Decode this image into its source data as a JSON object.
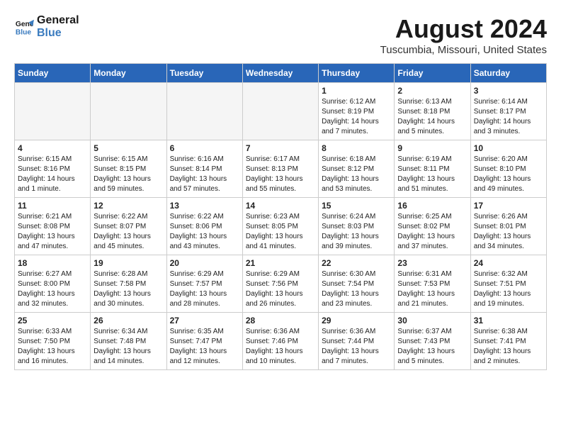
{
  "header": {
    "logo_line1": "General",
    "logo_line2": "Blue",
    "month_title": "August 2024",
    "location": "Tuscumbia, Missouri, United States"
  },
  "weekdays": [
    "Sunday",
    "Monday",
    "Tuesday",
    "Wednesday",
    "Thursday",
    "Friday",
    "Saturday"
  ],
  "weeks": [
    [
      {
        "day": "",
        "info": ""
      },
      {
        "day": "",
        "info": ""
      },
      {
        "day": "",
        "info": ""
      },
      {
        "day": "",
        "info": ""
      },
      {
        "day": "1",
        "info": "Sunrise: 6:12 AM\nSunset: 8:19 PM\nDaylight: 14 hours\nand 7 minutes."
      },
      {
        "day": "2",
        "info": "Sunrise: 6:13 AM\nSunset: 8:18 PM\nDaylight: 14 hours\nand 5 minutes."
      },
      {
        "day": "3",
        "info": "Sunrise: 6:14 AM\nSunset: 8:17 PM\nDaylight: 14 hours\nand 3 minutes."
      }
    ],
    [
      {
        "day": "4",
        "info": "Sunrise: 6:15 AM\nSunset: 8:16 PM\nDaylight: 14 hours\nand 1 minute."
      },
      {
        "day": "5",
        "info": "Sunrise: 6:15 AM\nSunset: 8:15 PM\nDaylight: 13 hours\nand 59 minutes."
      },
      {
        "day": "6",
        "info": "Sunrise: 6:16 AM\nSunset: 8:14 PM\nDaylight: 13 hours\nand 57 minutes."
      },
      {
        "day": "7",
        "info": "Sunrise: 6:17 AM\nSunset: 8:13 PM\nDaylight: 13 hours\nand 55 minutes."
      },
      {
        "day": "8",
        "info": "Sunrise: 6:18 AM\nSunset: 8:12 PM\nDaylight: 13 hours\nand 53 minutes."
      },
      {
        "day": "9",
        "info": "Sunrise: 6:19 AM\nSunset: 8:11 PM\nDaylight: 13 hours\nand 51 minutes."
      },
      {
        "day": "10",
        "info": "Sunrise: 6:20 AM\nSunset: 8:10 PM\nDaylight: 13 hours\nand 49 minutes."
      }
    ],
    [
      {
        "day": "11",
        "info": "Sunrise: 6:21 AM\nSunset: 8:08 PM\nDaylight: 13 hours\nand 47 minutes."
      },
      {
        "day": "12",
        "info": "Sunrise: 6:22 AM\nSunset: 8:07 PM\nDaylight: 13 hours\nand 45 minutes."
      },
      {
        "day": "13",
        "info": "Sunrise: 6:22 AM\nSunset: 8:06 PM\nDaylight: 13 hours\nand 43 minutes."
      },
      {
        "day": "14",
        "info": "Sunrise: 6:23 AM\nSunset: 8:05 PM\nDaylight: 13 hours\nand 41 minutes."
      },
      {
        "day": "15",
        "info": "Sunrise: 6:24 AM\nSunset: 8:03 PM\nDaylight: 13 hours\nand 39 minutes."
      },
      {
        "day": "16",
        "info": "Sunrise: 6:25 AM\nSunset: 8:02 PM\nDaylight: 13 hours\nand 37 minutes."
      },
      {
        "day": "17",
        "info": "Sunrise: 6:26 AM\nSunset: 8:01 PM\nDaylight: 13 hours\nand 34 minutes."
      }
    ],
    [
      {
        "day": "18",
        "info": "Sunrise: 6:27 AM\nSunset: 8:00 PM\nDaylight: 13 hours\nand 32 minutes."
      },
      {
        "day": "19",
        "info": "Sunrise: 6:28 AM\nSunset: 7:58 PM\nDaylight: 13 hours\nand 30 minutes."
      },
      {
        "day": "20",
        "info": "Sunrise: 6:29 AM\nSunset: 7:57 PM\nDaylight: 13 hours\nand 28 minutes."
      },
      {
        "day": "21",
        "info": "Sunrise: 6:29 AM\nSunset: 7:56 PM\nDaylight: 13 hours\nand 26 minutes."
      },
      {
        "day": "22",
        "info": "Sunrise: 6:30 AM\nSunset: 7:54 PM\nDaylight: 13 hours\nand 23 minutes."
      },
      {
        "day": "23",
        "info": "Sunrise: 6:31 AM\nSunset: 7:53 PM\nDaylight: 13 hours\nand 21 minutes."
      },
      {
        "day": "24",
        "info": "Sunrise: 6:32 AM\nSunset: 7:51 PM\nDaylight: 13 hours\nand 19 minutes."
      }
    ],
    [
      {
        "day": "25",
        "info": "Sunrise: 6:33 AM\nSunset: 7:50 PM\nDaylight: 13 hours\nand 16 minutes."
      },
      {
        "day": "26",
        "info": "Sunrise: 6:34 AM\nSunset: 7:48 PM\nDaylight: 13 hours\nand 14 minutes."
      },
      {
        "day": "27",
        "info": "Sunrise: 6:35 AM\nSunset: 7:47 PM\nDaylight: 13 hours\nand 12 minutes."
      },
      {
        "day": "28",
        "info": "Sunrise: 6:36 AM\nSunset: 7:46 PM\nDaylight: 13 hours\nand 10 minutes."
      },
      {
        "day": "29",
        "info": "Sunrise: 6:36 AM\nSunset: 7:44 PM\nDaylight: 13 hours\nand 7 minutes."
      },
      {
        "day": "30",
        "info": "Sunrise: 6:37 AM\nSunset: 7:43 PM\nDaylight: 13 hours\nand 5 minutes."
      },
      {
        "day": "31",
        "info": "Sunrise: 6:38 AM\nSunset: 7:41 PM\nDaylight: 13 hours\nand 2 minutes."
      }
    ]
  ]
}
